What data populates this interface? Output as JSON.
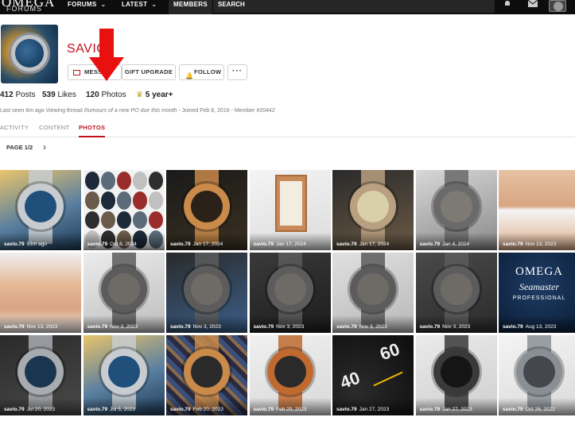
{
  "topnav": {
    "logo_line1": "OMEGA",
    "logo_line2": "FORUMS",
    "forums": "FORUMS",
    "latest": "LATEST",
    "members": "MEMBERS",
    "search": "SEARCH"
  },
  "profile": {
    "name": "SAVIO",
    "buttons": {
      "message": "MESSA",
      "gift": "GIFT UPGRADE",
      "follow": "FOLLOW",
      "more": "···"
    },
    "stats": {
      "posts_count": "412",
      "posts_label": "Posts",
      "likes_count": "539",
      "likes_label": "Likes",
      "photos_count": "120",
      "photos_label": "Photos",
      "tenure": "5 year+"
    },
    "last_seen_prefix": "Last seen 6m ago Viewing thread ",
    "last_seen_thread": "Rumours of a new PO due this month",
    "last_seen_suffix": " - Joined Feb 8, 2016 - Member #20442"
  },
  "tabs": [
    "ACTIVITY",
    "CONTENT",
    "PHOTOS"
  ],
  "active_tab": "PHOTOS",
  "pager": {
    "label": "PAGE 1/2"
  },
  "colors": {
    "brand_red": "#c1121f",
    "nav_bg": "#0d0d0d"
  },
  "photos": [
    {
      "user": "savio.79",
      "date": "51m ago"
    },
    {
      "user": "savio.79",
      "date": "Oct 8, 2024"
    },
    {
      "user": "savio.79",
      "date": "Jan 17, 2024"
    },
    {
      "user": "savio.79",
      "date": "Jan 17, 2024"
    },
    {
      "user": "savio.79",
      "date": "Jan 17, 2024"
    },
    {
      "user": "savio.79",
      "date": "Jan 4, 2024"
    },
    {
      "user": "savio.79",
      "date": "Nov 13, 2023"
    },
    {
      "user": "savio.79",
      "date": "Nov 13, 2023"
    },
    {
      "user": "savio.79",
      "date": "Nov 3, 2023"
    },
    {
      "user": "savio.79",
      "date": "Nov 3, 2023"
    },
    {
      "user": "savio.79",
      "date": "Nov 3, 2023"
    },
    {
      "user": "savio.79",
      "date": "Nov 3, 2023"
    },
    {
      "user": "savio.79",
      "date": "Nov 3, 2023"
    },
    {
      "user": "savio.79",
      "date": "Aug 13, 2023"
    },
    {
      "user": "savio.79",
      "date": "Jul 20, 2023"
    },
    {
      "user": "savio.79",
      "date": "Jul 5, 2023"
    },
    {
      "user": "savio.79",
      "date": "Feb 20, 2023"
    },
    {
      "user": "savio.79",
      "date": "Feb 20, 2023"
    },
    {
      "user": "savio.79",
      "date": "Jan 27, 2023"
    },
    {
      "user": "savio.79",
      "date": "Jan 27, 2023"
    },
    {
      "user": "savio.79",
      "date": "Oct 26, 2022"
    }
  ],
  "watermark_text": {
    "omega": "OMEGA",
    "seamaster": "Seamaster",
    "professional": "PROFESSIONAL"
  }
}
